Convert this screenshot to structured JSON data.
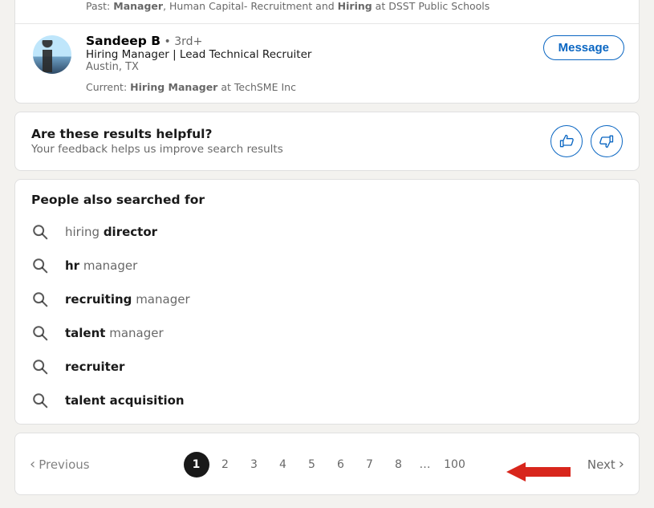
{
  "result_prev": {
    "past_label": "Past:",
    "role": "Manager",
    "mid": ", Human Capital- Recruitment and ",
    "role2": "Hiring",
    "tail": " at DSST Public Schools"
  },
  "result": {
    "name": "Sandeep B",
    "sep": " • ",
    "degree": "3rd+",
    "headline": "Hiring Manager | Lead Technical Recruiter",
    "location": "Austin, TX",
    "current_label": "Current:",
    "current_role": "Hiring Manager",
    "current_tail": " at TechSME Inc",
    "message": "Message"
  },
  "feedback": {
    "q": "Are these results helpful?",
    "sub": "Your feedback helps us improve search results"
  },
  "related": {
    "heading": "People also searched for",
    "items": [
      {
        "pre": "hiring ",
        "bold": "director",
        "post": ""
      },
      {
        "pre": "",
        "bold": "hr",
        "post": " manager"
      },
      {
        "pre": "",
        "bold": "recruiting",
        "post": " manager"
      },
      {
        "pre": "",
        "bold": "talent",
        "post": " manager"
      },
      {
        "pre": "",
        "bold": "recruiter",
        "post": ""
      },
      {
        "pre": "",
        "bold": "talent acquisition",
        "post": ""
      }
    ]
  },
  "pager": {
    "previous": "Previous",
    "next": "Next",
    "pages": [
      "1",
      "2",
      "3",
      "4",
      "5",
      "6",
      "7",
      "8"
    ],
    "ellipsis": "…",
    "last": "100"
  }
}
